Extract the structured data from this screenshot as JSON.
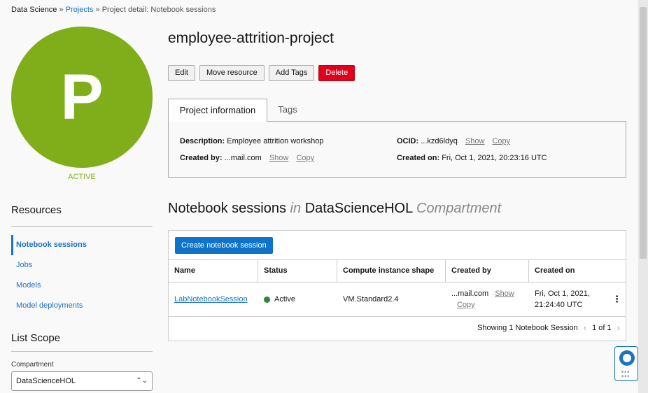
{
  "breadcrumb": {
    "root": "Data Science",
    "sep1": "»",
    "projects": "Projects",
    "sep2": "»",
    "current": "Project detail: Notebook sessions"
  },
  "project": {
    "avatar_letter": "P",
    "state": "ACTIVE",
    "name": "employee-attrition-project"
  },
  "actions": {
    "edit": "Edit",
    "move": "Move resource",
    "tags": "Add Tags",
    "delete": "Delete"
  },
  "tabs": {
    "info": "Project information",
    "tags": "Tags"
  },
  "info": {
    "description_label": "Description:",
    "description_value": "Employee attrition workshop",
    "created_by_label": "Created by:",
    "created_by_value": "...mail.com",
    "ocid_label": "OCID:",
    "ocid_value": "...kzd6ldyq",
    "created_on_label": "Created on:",
    "created_on_value": "Fri, Oct 1, 2021, 20:23:16 UTC",
    "show": "Show",
    "copy": "Copy"
  },
  "sidebar": {
    "resources_heading": "Resources",
    "items": [
      {
        "label": "Notebook sessions"
      },
      {
        "label": "Jobs"
      },
      {
        "label": "Models"
      },
      {
        "label": "Model deployments"
      }
    ],
    "list_scope_heading": "List Scope",
    "compartment_label": "Compartment",
    "compartment_value": "DataScienceHOL"
  },
  "section": {
    "title_main": "Notebook sessions",
    "title_in": "in",
    "title_compartment": "DataScienceHOL",
    "title_suffix": "Compartment"
  },
  "table": {
    "create_button": "Create notebook session",
    "columns": [
      "Name",
      "Status",
      "Compute instance shape",
      "Created by",
      "Created on"
    ],
    "rows": [
      {
        "name": "LabNotebookSession",
        "status": "Active",
        "shape": "VM.Standard2.4",
        "created_by": "...mail.com",
        "show": "Show",
        "copy": "Copy",
        "created_on_line1": "Fri, Oct 1, 2021,",
        "created_on_line2": "21:24:40 UTC"
      }
    ],
    "footer_text": "Showing 1 Notebook Session",
    "pager": "1 of 1"
  },
  "colors": {
    "active_green": "#7fae1a",
    "link_blue": "#1a73c5",
    "delete_red": "#e0001b"
  }
}
